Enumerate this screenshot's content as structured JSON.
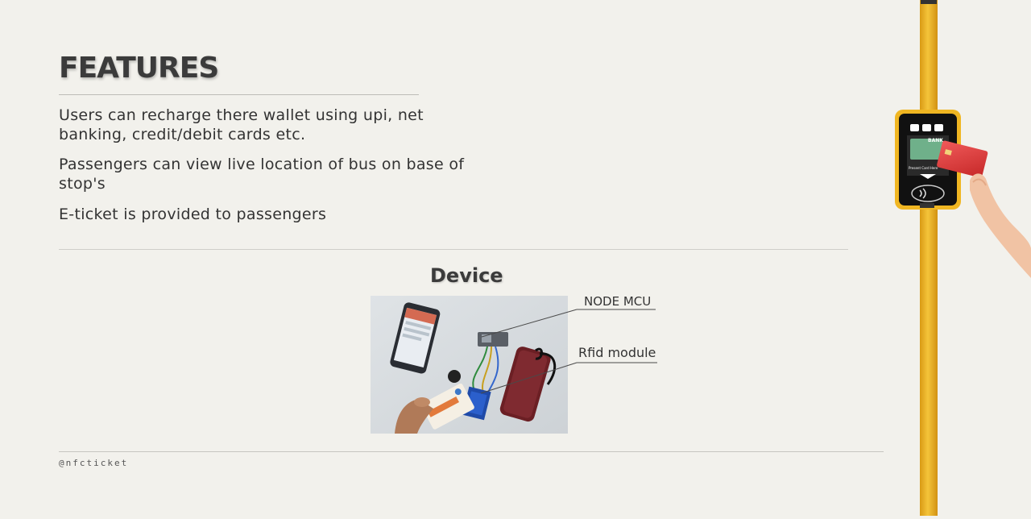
{
  "header": {
    "title": "FEATURES"
  },
  "features": [
    "Users can recharge there wallet using upi, net banking, credit/debit cards etc.",
    "Passengers can view live location of bus on base of stop's",
    "E-ticket is provided to passengers"
  ],
  "device": {
    "title": "Device",
    "callouts": [
      "NODE MCU",
      "Rfid module"
    ]
  },
  "footer": {
    "handle": "@nfcticket"
  },
  "reader_screen": {
    "bank_label": "BANK",
    "prompt": "Present Card Here"
  },
  "colors": {
    "background": "#f2f1ec",
    "pole": "#f0b92a",
    "card": "#e03a3a"
  }
}
